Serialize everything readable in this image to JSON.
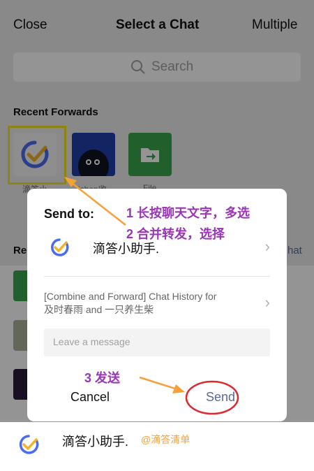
{
  "header": {
    "close": "Close",
    "title": "Select a Chat",
    "multiple": "Multiple"
  },
  "search": {
    "placeholder": "Search"
  },
  "recent_forwards": {
    "label": "Recent Forwards",
    "items": [
      {
        "caption": "滴答小",
        "icon": "check-logo-icon"
      },
      {
        "caption": "ichen收",
        "icon": "blob-avatar-icon"
      },
      {
        "caption": "File",
        "icon": "file-transfer-icon"
      }
    ]
  },
  "recent_chats": {
    "label": "Re",
    "right_link": "hat"
  },
  "bottom_row": {
    "name": "滴答小助手.",
    "sub": "@滴答清单"
  },
  "dialog": {
    "send_to": "Send to:",
    "recipient": "滴答小助手.",
    "history_line1": "[Combine and Forward] Chat History for",
    "history_line2": "及时春雨 and 一只养生柴",
    "message_placeholder": "Leave a message",
    "cancel": "Cancel",
    "send": "Send"
  },
  "annotations": {
    "step1": "1 长按聊天文字，多选",
    "step2": "2 合并转发，选择",
    "step3": "3 发送"
  },
  "colors": {
    "accent_annotation": "#9b35b8",
    "highlight_box": "#f5e31b",
    "send_blue": "#576b95",
    "arrow": "#f5a13a",
    "circle": "#e0262f"
  }
}
